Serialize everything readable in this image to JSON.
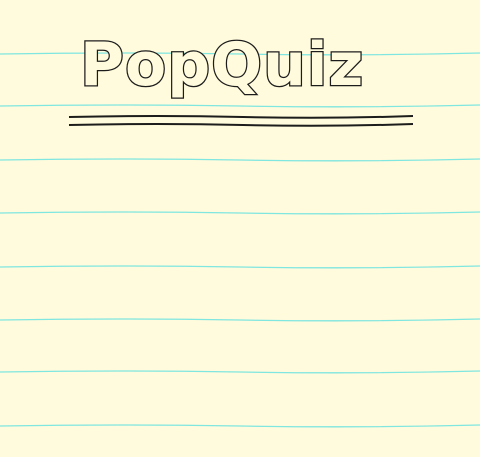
{
  "title": {
    "text": "PopQuiz"
  },
  "colors": {
    "paper": "#fffbdc",
    "rule_line": "#7fe6e0",
    "ink": "#1c1c1c"
  }
}
